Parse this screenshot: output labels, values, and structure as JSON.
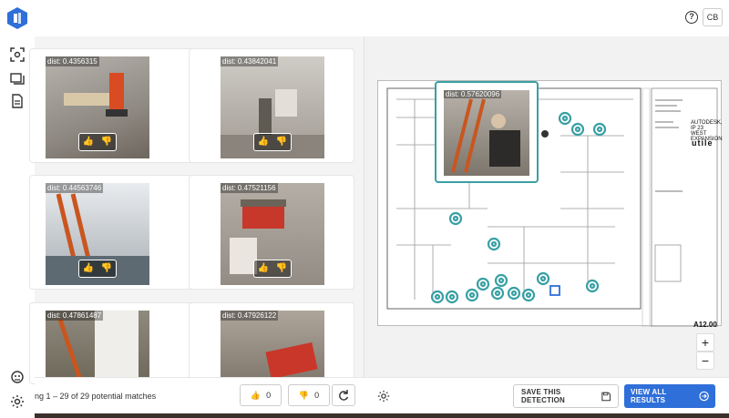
{
  "header": {
    "help_icon": "?",
    "user_initials": "CB"
  },
  "results": {
    "cards": [
      {
        "dist": "dist: 0.4356315"
      },
      {
        "dist": "dist: 0.43842041"
      },
      {
        "dist": "dist: 0.44563746"
      },
      {
        "dist": "dist: 0.47521156"
      },
      {
        "dist": "dist: 0.47861487"
      },
      {
        "dist": "dist: 0.47926122"
      }
    ]
  },
  "popup": {
    "dist": "dist: 0.57620096"
  },
  "plan": {
    "title_block": "AUTODESK, IP 23 WEST EXPANSION",
    "brand": "utile",
    "sheet_number": "A12.00"
  },
  "footer": {
    "showing_text": "ng 1 – 29 of 29 potential matches",
    "thumbs_up_count": "0",
    "thumbs_down_count": "0",
    "save_label": "SAVE THIS DETECTION",
    "view_all_label": "VIEW ALL RESULTS"
  },
  "zoom": {
    "in": "+",
    "out": "−"
  },
  "colors": {
    "accent": "#2f6fd9",
    "marker": "#39a0a4"
  }
}
